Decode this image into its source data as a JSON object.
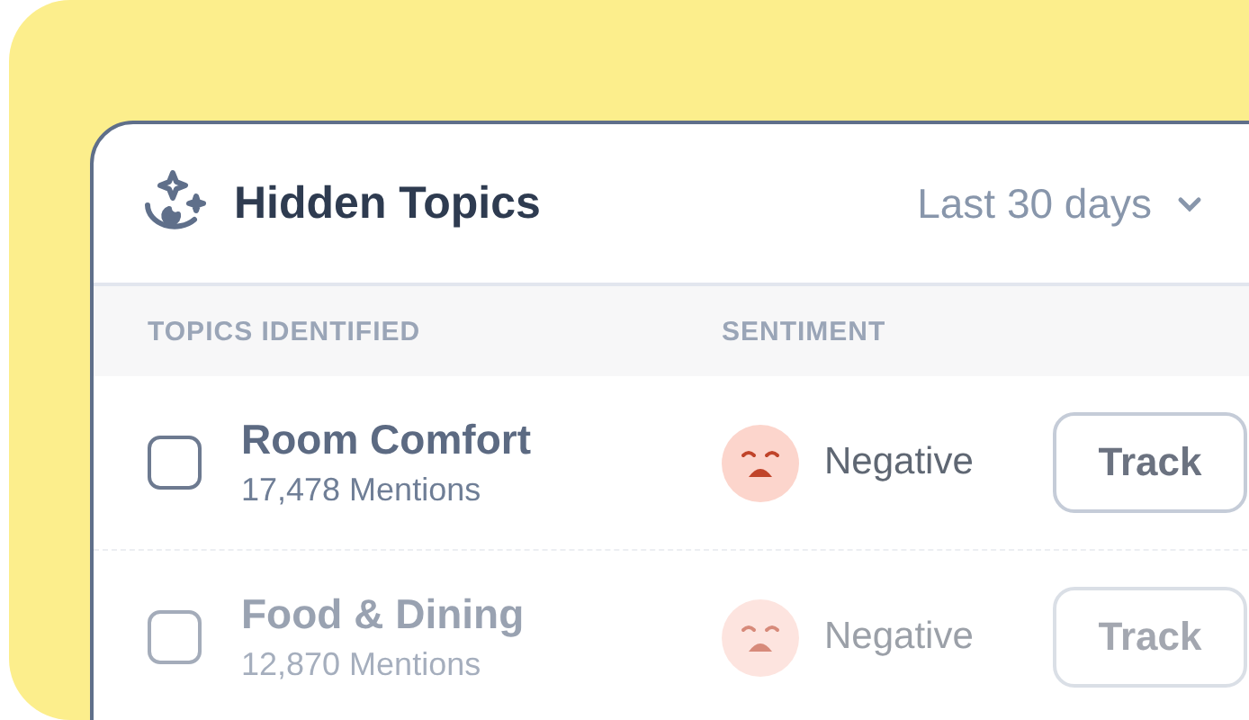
{
  "header": {
    "title": "Hidden Topics",
    "range": "Last 30 days"
  },
  "columns": [
    "TOPICS IDENTIFIED",
    "SENTIMENT"
  ],
  "rows": [
    {
      "topic": "Room Comfort",
      "mentions": "17,478 Mentions",
      "sentiment": "Negative",
      "action": "Track",
      "checked": false,
      "dimmed": false
    },
    {
      "topic": "Food & Dining",
      "mentions": "12,870 Mentions",
      "sentiment": "Negative",
      "action": "Track",
      "checked": false,
      "dimmed": true
    }
  ]
}
